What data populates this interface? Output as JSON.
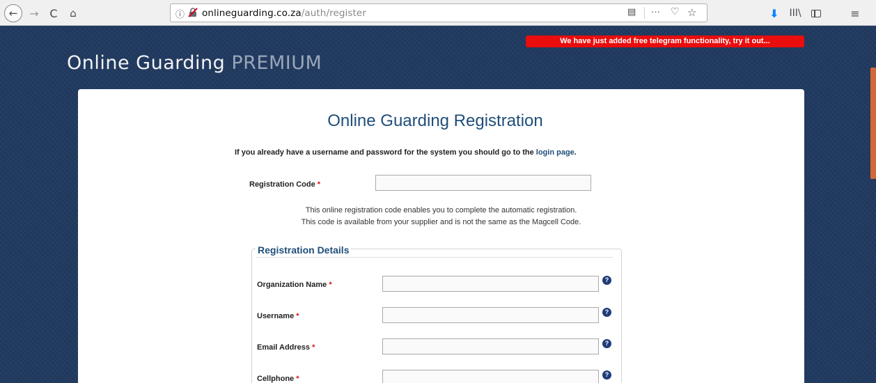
{
  "browser": {
    "back_icon": "←",
    "forward_icon": "→",
    "reload_icon": "C",
    "home_icon": "⌂",
    "info_icon": "ⓘ",
    "url_domain": "onlineguarding.co.za",
    "url_path": "/auth/register",
    "reader_icon": "▤",
    "more_icon": "···",
    "pocket_icon": "♡",
    "star_icon": "☆",
    "download_icon": "⬇",
    "library_icon": "III\\",
    "menu_icon": "≡"
  },
  "banner": {
    "text": "We have just added free telegram functionality, try it out..."
  },
  "logo": {
    "main": "Online Guarding",
    "premium": "PREMIUM"
  },
  "form": {
    "title": "Online Guarding Registration",
    "login_note_prefix": "If you already have a username and password for the system you should go to the",
    "login_link": "login page",
    "login_note_suffix": ".",
    "registration_code_label": "Registration Code",
    "required_marker": "*",
    "code_desc_line1": "This online registration code enables you to complete the automatic registration.",
    "code_desc_line2": "This code is available from your supplier and is not the same as the Magcell Code.",
    "details_legend": "Registration Details",
    "help_glyph": "?",
    "fields": [
      {
        "label": "Organization Name"
      },
      {
        "label": "Username"
      },
      {
        "label": "Email Address"
      },
      {
        "label": "Cellphone"
      }
    ]
  },
  "colors": {
    "banner_bg": "#e90d0d",
    "title": "#1f4e79",
    "page_bg": "#213a60"
  }
}
